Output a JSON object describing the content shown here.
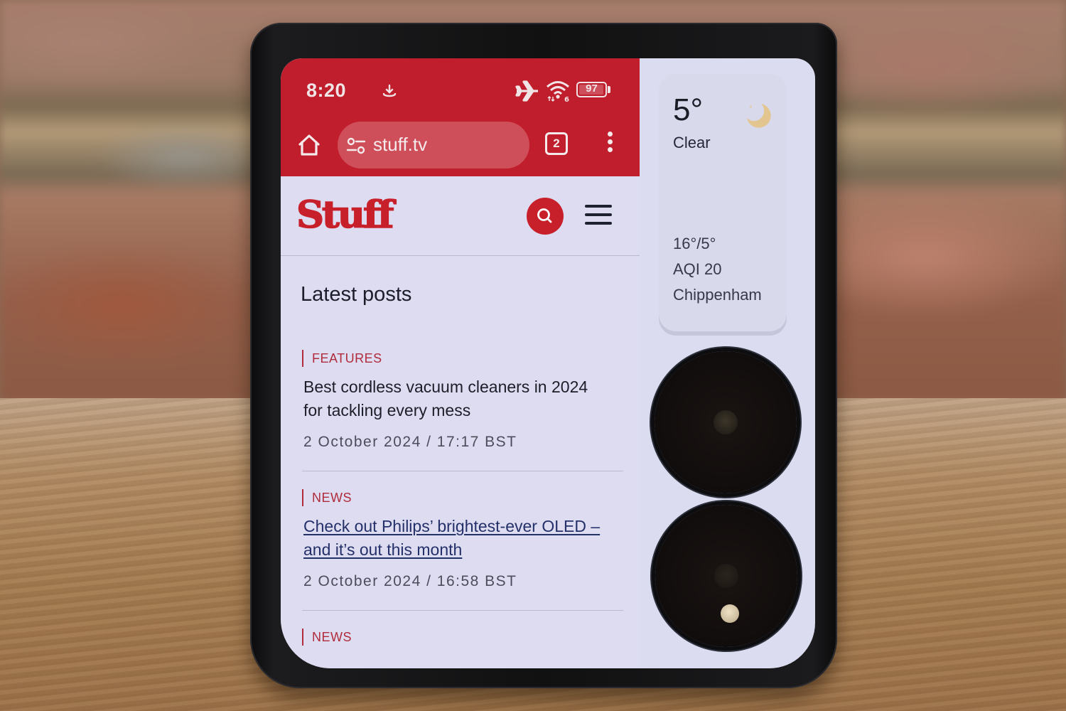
{
  "status_bar": {
    "time": "8:20",
    "battery_level": "97",
    "battery_fraction": 0.97,
    "icons": [
      "download-icon",
      "airplane-mode-icon",
      "wifi-6-icon",
      "battery-icon"
    ]
  },
  "browser": {
    "url": "stuff.tv",
    "tab_count": "2",
    "accent_color": "#c01e2c",
    "icons": [
      "home-icon",
      "site-settings-icon",
      "tab-switcher-icon",
      "overflow-menu-icon"
    ]
  },
  "site": {
    "logo_text": "Stuff",
    "brand_color": "#c8202b",
    "section_title": "Latest posts",
    "posts": [
      {
        "category": "FEATURES",
        "title": "Best cordless vacuum cleaners in 2024 for tackling every mess",
        "date": "2 October 2024 / 17:17 BST"
      },
      {
        "category": "NEWS",
        "title": "Check out Philips’ brightest-ever OLED – and it’s out this month",
        "date": "2 October 2024 / 16:58 BST"
      },
      {
        "category": "NEWS"
      }
    ]
  },
  "weather_widget": {
    "temperature": "5°",
    "condition": "Clear",
    "high_low": "16°/5°",
    "aqi": "AQI 20",
    "location": "Chippenham"
  }
}
